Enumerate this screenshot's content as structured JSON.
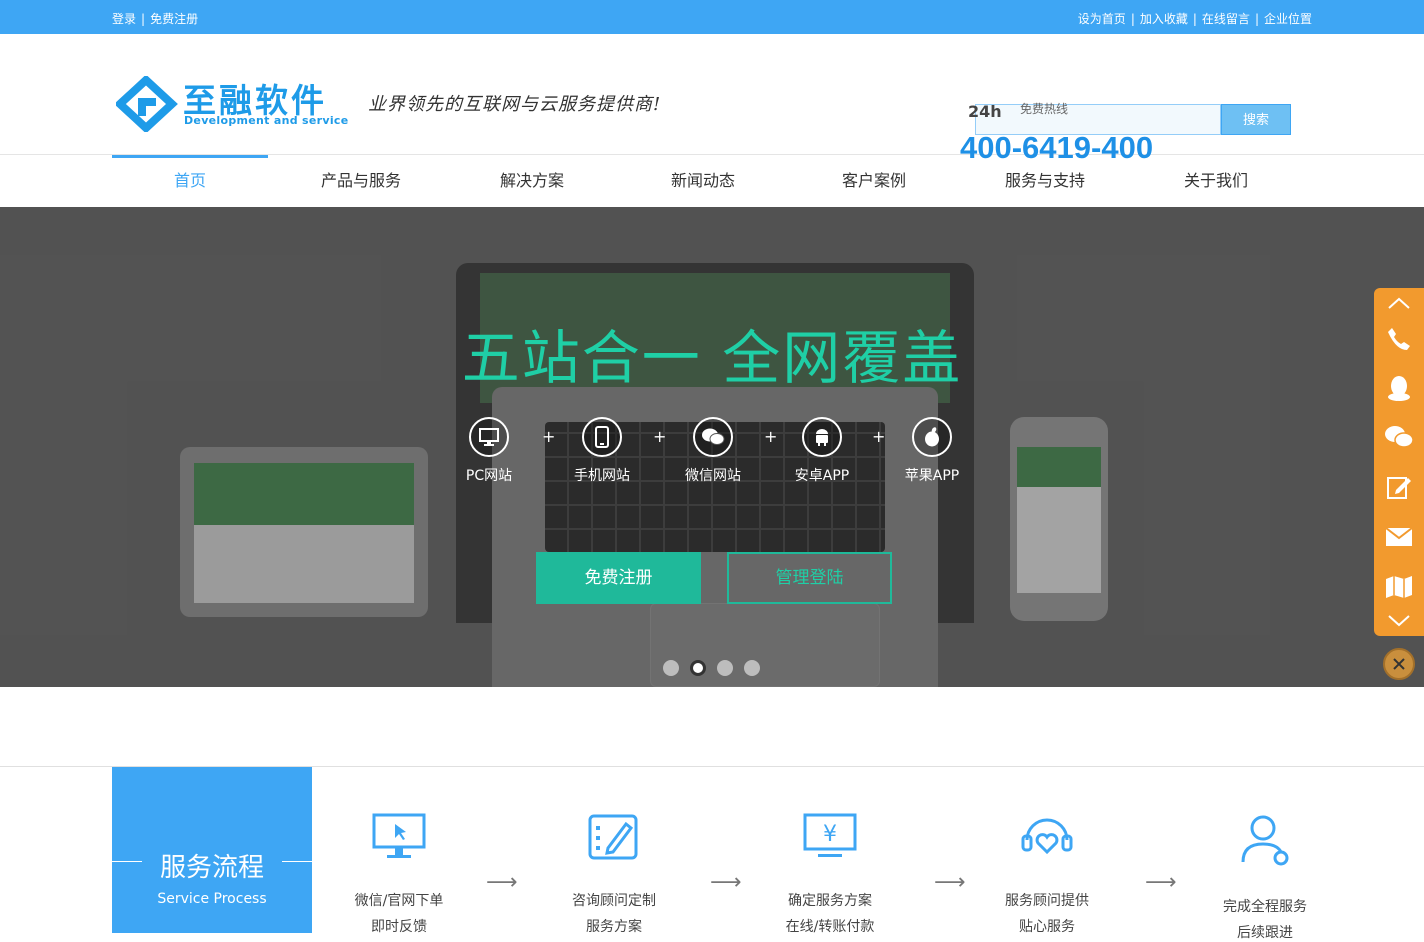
{
  "topbar": {
    "login": "登录",
    "register": "免费注册",
    "links": [
      "设为首页",
      "加入收藏",
      "在线留言",
      "企业位置"
    ]
  },
  "header": {
    "logo_name": "至融软件",
    "logo_sub": "Development and service",
    "slogan": "业界领先的互联网与云服务提供商!",
    "hotline_badge": "24h",
    "hotline_label": "免费热线",
    "phone": "400-6419-400",
    "search_button": "搜索"
  },
  "nav": {
    "items": [
      "首页",
      "产品与服务",
      "解决方案",
      "新闻动态",
      "客户案例",
      "服务与支持",
      "关于我们"
    ],
    "active_index": 0
  },
  "banner": {
    "title": "五站合一 全网覆盖",
    "platforms": [
      "PC网站",
      "手机网站",
      "微信网站",
      "安卓APP",
      "苹果APP"
    ],
    "plus": "+",
    "register_button": "免费注册",
    "login_button": "管理登陆",
    "slide_count": 4,
    "active_slide": 1
  },
  "sidebar_icons": [
    "chevron-up-icon",
    "phone-icon",
    "qq-icon",
    "wechat-icon",
    "edit-icon",
    "mail-icon",
    "map-icon",
    "chevron-down-icon"
  ],
  "process": {
    "title": "服务流程",
    "subtitle": "Service Process",
    "steps": [
      {
        "line1": "微信/官网下单",
        "line2": "即时反馈"
      },
      {
        "line1": "咨询顾问定制",
        "line2": "服务方案"
      },
      {
        "line1": "确定服务方案",
        "line2": "在线/转账付款"
      },
      {
        "line1": "服务顾问提供",
        "line2": "贴心服务"
      },
      {
        "line1": "完成全程服务",
        "line2": "后续跟进"
      }
    ]
  },
  "colors": {
    "primary": "#3ea6f4",
    "accent_green": "#1fb99a",
    "side_orange": "#f29a2e"
  }
}
